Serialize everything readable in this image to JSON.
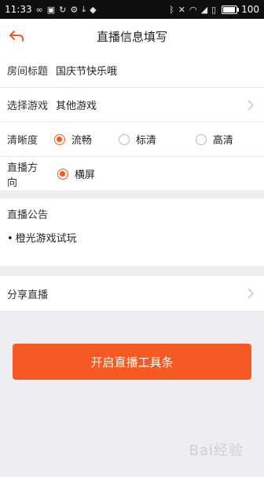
{
  "status_bar": {
    "time": "11:33",
    "battery": "100"
  },
  "header": {
    "title": "直播信息填写"
  },
  "form": {
    "room_title": {
      "label": "房间标题",
      "value": "国庆节快乐哦"
    },
    "select_game": {
      "label": "选择游戏",
      "value": "其他游戏"
    },
    "quality": {
      "label": "清晰度",
      "options": [
        "流畅",
        "标清",
        "高清"
      ],
      "selected": "流畅"
    },
    "orientation": {
      "label": "直播方向",
      "options": [
        "横屏"
      ],
      "selected": "横屏"
    }
  },
  "notice": {
    "label": "直播公告",
    "text": "橙光游戏试玩"
  },
  "share": {
    "label": "分享直播"
  },
  "start_button": {
    "label": "开启直播工具条"
  },
  "watermark": "Bai经验",
  "colors": {
    "accent": "#f45a22",
    "background": "#eeeef2"
  }
}
